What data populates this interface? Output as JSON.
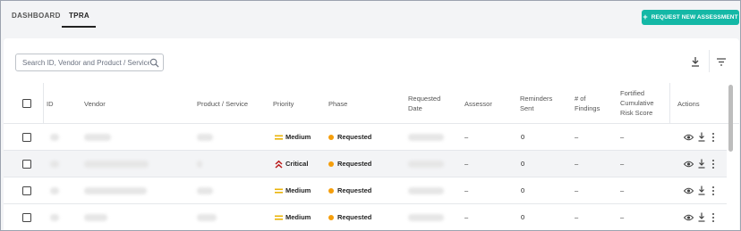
{
  "nav": {
    "tabs": [
      {
        "label": "DASHBOARD",
        "active": false
      },
      {
        "label": "TPRA",
        "active": true
      }
    ],
    "request_button": {
      "label": "REQUEST NEW ASSESSMENT",
      "icon": "plus-icon"
    }
  },
  "colors": {
    "accent": "#14b8a6",
    "priority_medium": "#eab308",
    "priority_critical": "#b91c1c",
    "phase_requested": "#f59e0b"
  },
  "toolbar": {
    "search_placeholder": "Search ID, Vendor and Product / Service",
    "icons": [
      "search-icon",
      "download-icon",
      "filter-icon"
    ]
  },
  "table": {
    "headers": {
      "id": "ID",
      "vendor": "Vendor",
      "product": "Product / Service",
      "priority": "Priority",
      "phase": "Phase",
      "requested_date_1": "Requested",
      "requested_date_2": "Date",
      "assessor": "Assessor",
      "reminders_1": "Reminders",
      "reminders_2": "Sent",
      "findings_1": "# of",
      "findings_2": "Findings",
      "fortified_1": "Fortified",
      "fortified_2": "Cumulative",
      "fortified_3": "Risk Score",
      "actions": "Actions"
    },
    "rows": [
      {
        "priority": "Medium",
        "priority_icon": "equals-icon",
        "phase": "Requested",
        "assessor": "–",
        "reminders": "0",
        "findings": "–",
        "risk_score": "–",
        "highlighted": false
      },
      {
        "priority": "Critical",
        "priority_icon": "double-chevron-up-icon",
        "phase": "Requested",
        "assessor": "–",
        "reminders": "0",
        "findings": "–",
        "risk_score": "–",
        "highlighted": true
      },
      {
        "priority": "Medium",
        "priority_icon": "equals-icon",
        "phase": "Requested",
        "assessor": "–",
        "reminders": "0",
        "findings": "–",
        "risk_score": "–",
        "highlighted": false
      },
      {
        "priority": "Medium",
        "priority_icon": "equals-icon",
        "phase": "Requested",
        "assessor": "–",
        "reminders": "0",
        "findings": "–",
        "risk_score": "–",
        "highlighted": false
      }
    ],
    "row_action_icons": [
      "eye-icon",
      "download-icon",
      "more-vertical-icon"
    ]
  }
}
